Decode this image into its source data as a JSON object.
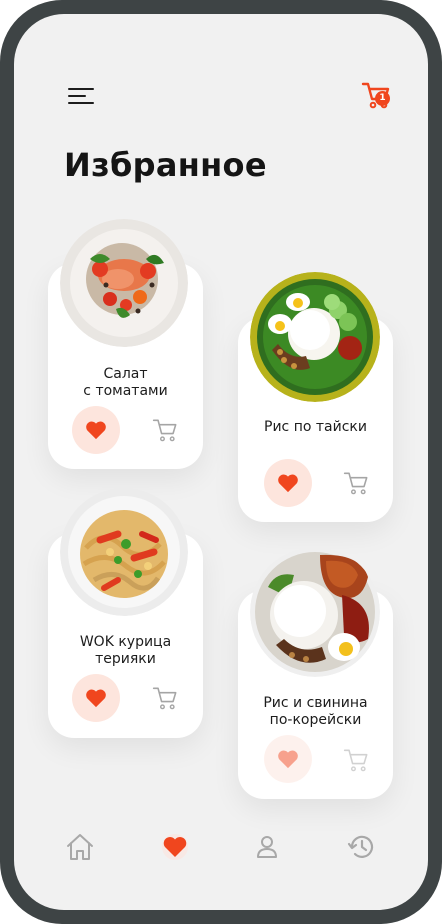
{
  "header": {
    "menu_icon": "menu-icon",
    "cart_icon": "cart-icon",
    "cart_count": "1"
  },
  "page": {
    "title": "Избранное"
  },
  "favorites": [
    {
      "name": "Салат\nс томатами",
      "favorite": true,
      "photo": "salad-plate"
    },
    {
      "name": "Рис по тайски",
      "favorite": true,
      "photo": "thai-rice-plate"
    },
    {
      "name": "WOK курица\nтерияки",
      "favorite": true,
      "photo": "wok-plate"
    },
    {
      "name": "Рис и свинина\nпо-корейски",
      "favorite": true,
      "photo": "korean-pork-plate"
    }
  ],
  "bottom_nav": [
    {
      "icon": "home-icon",
      "active": false
    },
    {
      "icon": "heart-icon",
      "active": true
    },
    {
      "icon": "profile-icon",
      "active": false
    },
    {
      "icon": "history-icon",
      "active": false
    }
  ],
  "colors": {
    "accent": "#f0461e",
    "accent_soft": "#fde5dd",
    "background": "#f1f1f1",
    "frame": "#3e4445"
  }
}
